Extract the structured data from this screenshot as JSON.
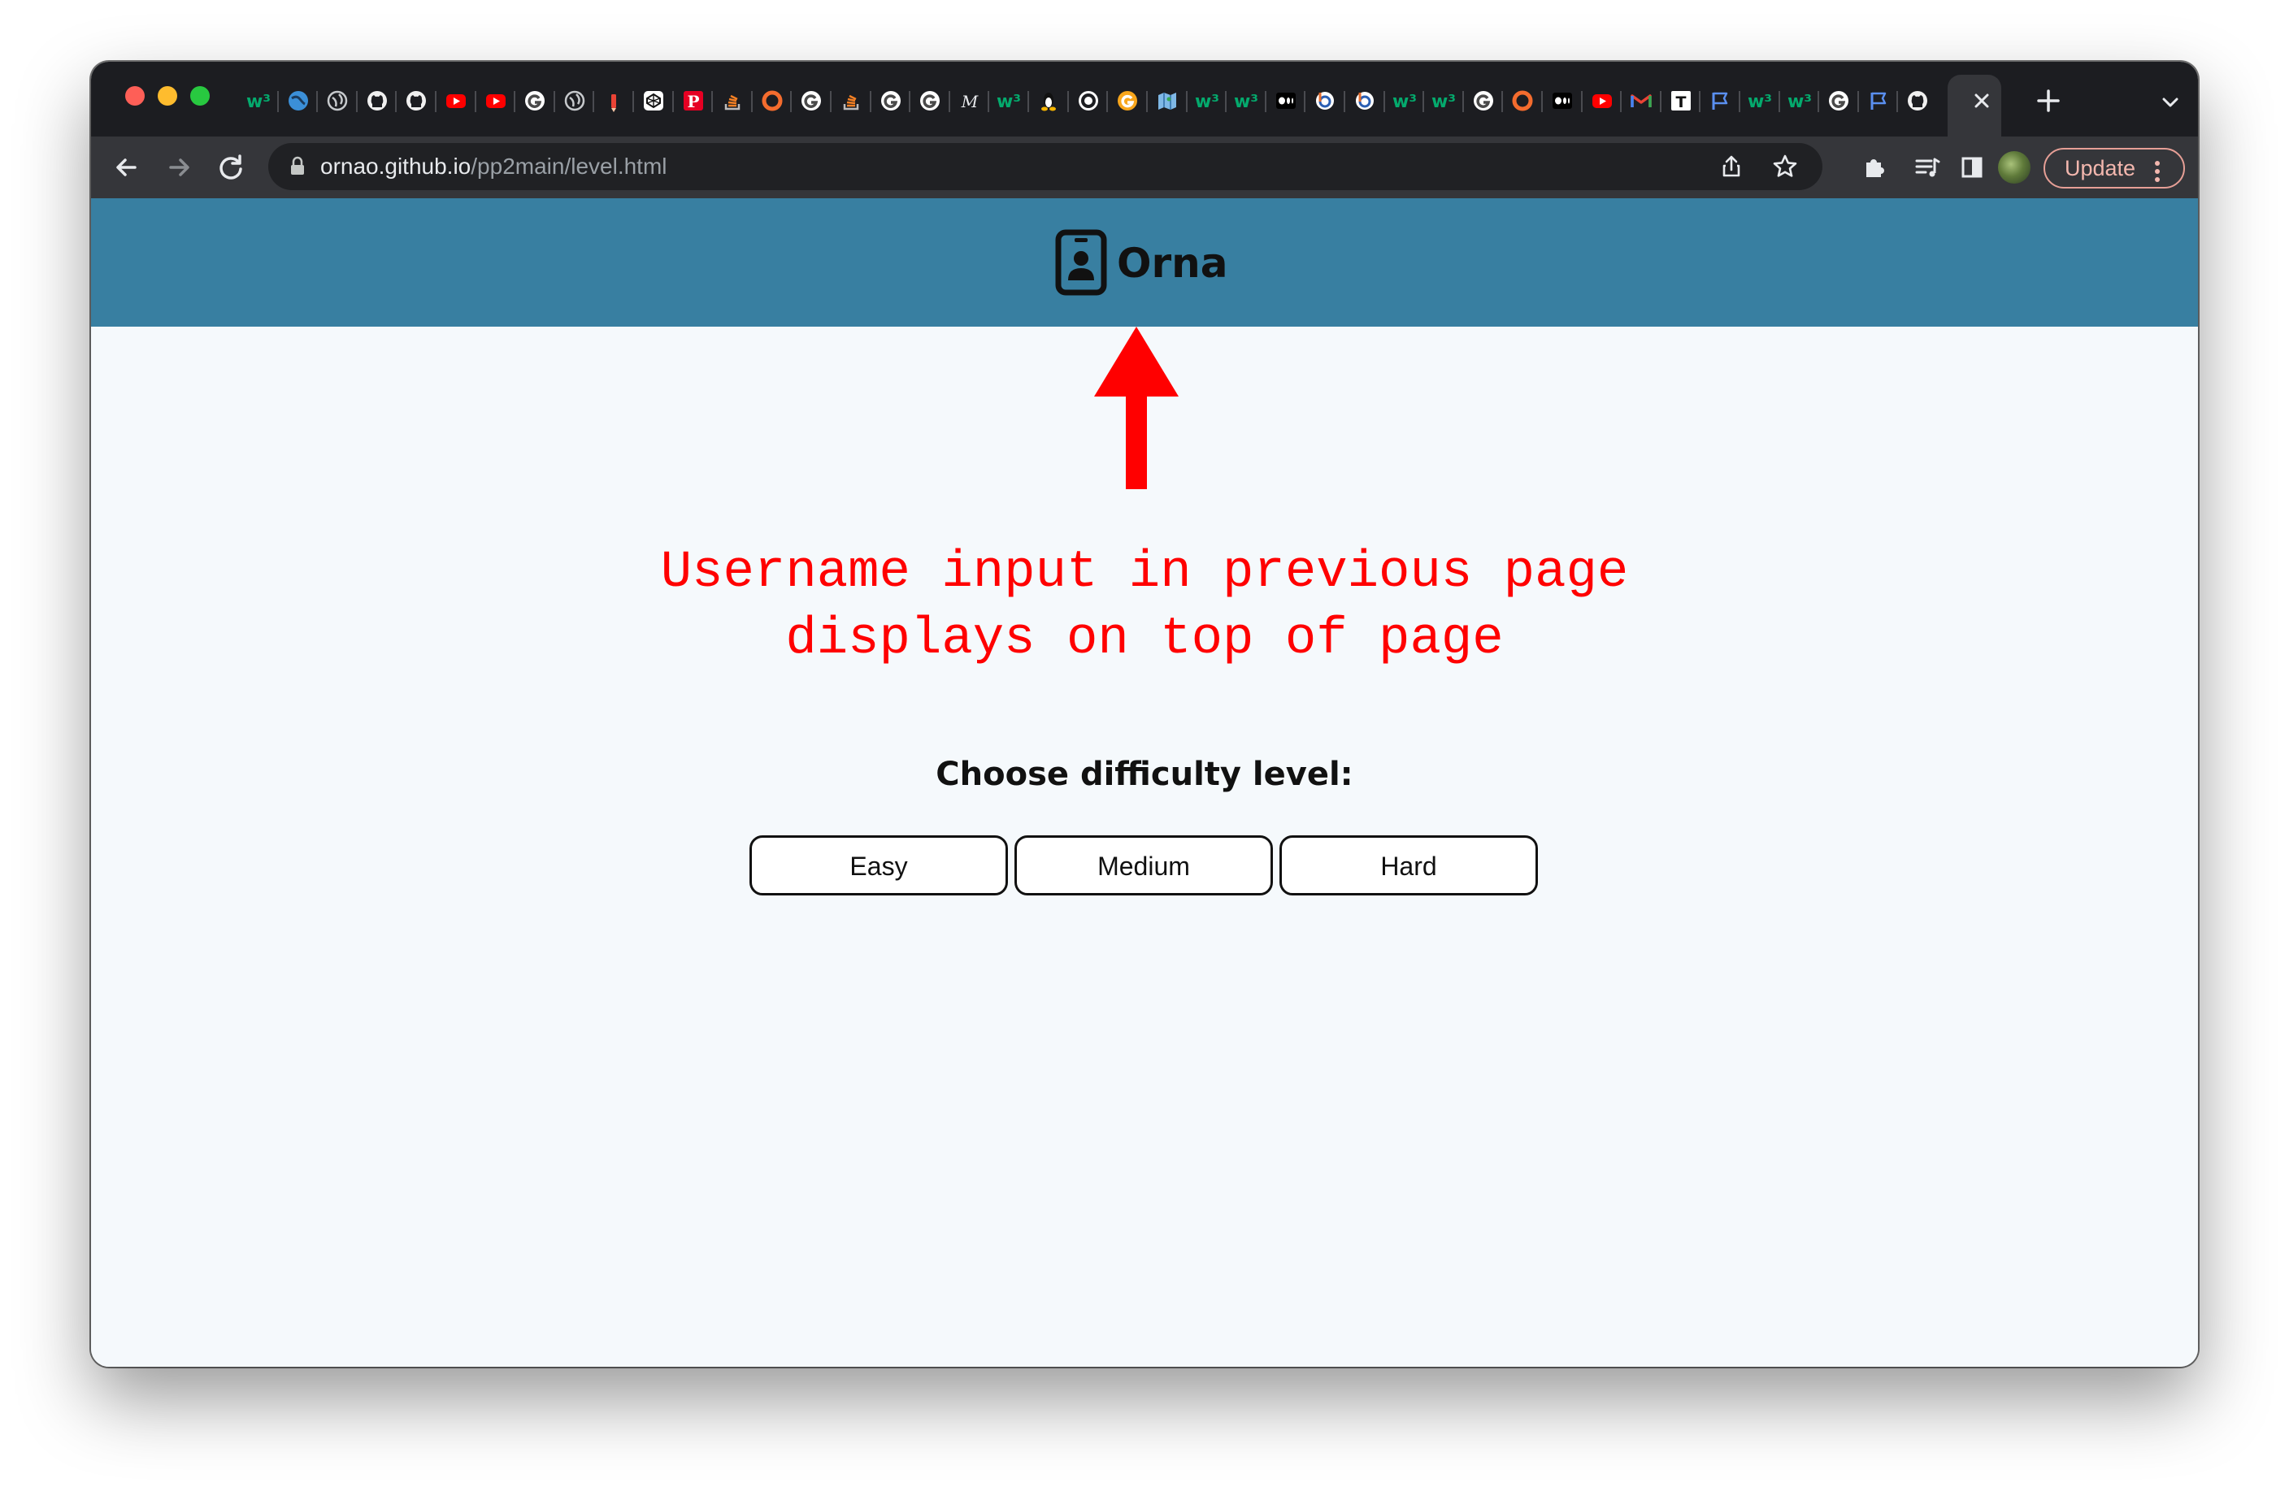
{
  "browser": {
    "url_host": "ornao.github.io",
    "url_path": "/pp2main/level.html",
    "update_label": "Update",
    "tabs": [
      {
        "icon": "w3schools-icon"
      },
      {
        "icon": "globe-blue-icon"
      },
      {
        "icon": "globe-icon"
      },
      {
        "icon": "github-icon"
      },
      {
        "icon": "github-icon"
      },
      {
        "icon": "youtube-icon"
      },
      {
        "icon": "youtube-icon"
      },
      {
        "icon": "google-icon"
      },
      {
        "icon": "globe-icon"
      },
      {
        "icon": "pencil-icon"
      },
      {
        "icon": "codepen-icon"
      },
      {
        "icon": "pinterest-icon"
      },
      {
        "icon": "stackoverflow-icon"
      },
      {
        "icon": "ring-icon"
      },
      {
        "icon": "google-icon"
      },
      {
        "icon": "stackoverflow-icon"
      },
      {
        "icon": "google-icon"
      },
      {
        "icon": "google-icon"
      },
      {
        "icon": "m-icon"
      },
      {
        "icon": "w3schools-icon"
      },
      {
        "icon": "linux-icon"
      },
      {
        "icon": "chrome-icon"
      },
      {
        "icon": "g-orange-icon"
      },
      {
        "icon": "map-icon"
      },
      {
        "icon": "w3schools-icon"
      },
      {
        "icon": "w3schools-icon"
      },
      {
        "icon": "medium-icon"
      },
      {
        "icon": "b-icon"
      },
      {
        "icon": "b-icon"
      },
      {
        "icon": "w3schools-icon"
      },
      {
        "icon": "w3schools-icon"
      },
      {
        "icon": "google-icon"
      },
      {
        "icon": "ring-icon"
      },
      {
        "icon": "medium-icon"
      },
      {
        "icon": "youtube-icon"
      },
      {
        "icon": "gmail-icon"
      },
      {
        "icon": "t-icon"
      },
      {
        "icon": "flag-icon"
      },
      {
        "icon": "w3schools-icon"
      },
      {
        "icon": "w3schools-icon"
      },
      {
        "icon": "google-icon"
      },
      {
        "icon": "flag-icon"
      },
      {
        "icon": "github-icon"
      }
    ]
  },
  "site": {
    "brand_name": "Orna",
    "choose_label": "Choose difficulty level:",
    "levels": [
      "Easy",
      "Medium",
      "Hard"
    ]
  },
  "annotation": {
    "lines": [
      "Username input in previous page",
      "displays on top of page"
    ],
    "color": "#ff0000"
  },
  "colors": {
    "header": "#387fa1",
    "page_bg": "#f5f9fc"
  }
}
